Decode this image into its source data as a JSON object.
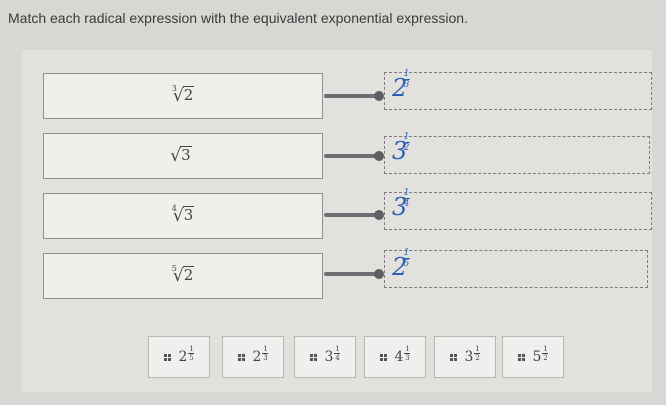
{
  "prompt": "Match each radical expression with the equivalent exponential expression.",
  "rows": [
    {
      "index": "3",
      "radicand": "2",
      "answer": {
        "base": "2",
        "num": "1",
        "den": "3"
      }
    },
    {
      "index": "",
      "radicand": "3",
      "answer": {
        "base": "3",
        "num": "1",
        "den": "2"
      }
    },
    {
      "index": "4",
      "radicand": "3",
      "answer": {
        "base": "3",
        "num": "1",
        "den": "4"
      }
    },
    {
      "index": "5",
      "radicand": "2",
      "answer": {
        "base": "2",
        "num": "1",
        "den": "5"
      }
    }
  ],
  "tiles": [
    {
      "base": "2",
      "num": "1",
      "den": "5"
    },
    {
      "base": "2",
      "num": "1",
      "den": "3"
    },
    {
      "base": "3",
      "num": "1",
      "den": "4"
    },
    {
      "base": "4",
      "num": "1",
      "den": "3"
    },
    {
      "base": "3",
      "num": "1",
      "den": "2"
    },
    {
      "base": "5",
      "num": "1",
      "den": "2"
    }
  ],
  "colors": {
    "handwriting": "#2a5fb4",
    "connector": "#6c6e72"
  },
  "icons": {
    "tile_handle": "drag-grip-icon"
  }
}
